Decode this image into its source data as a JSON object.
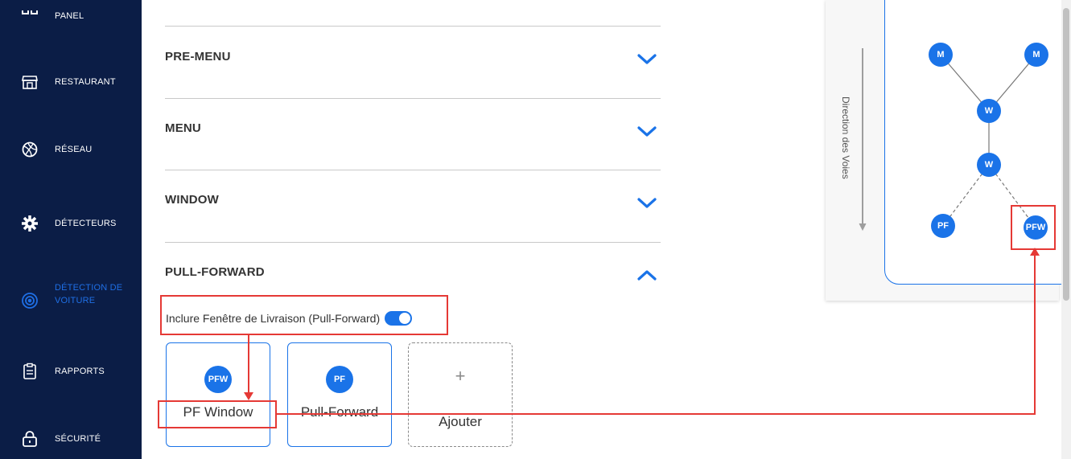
{
  "sidebar": {
    "items": [
      {
        "label": "PANEL",
        "icon": "dashboard-icon"
      },
      {
        "label": "RESTAURANT",
        "icon": "store-icon"
      },
      {
        "label": "RÉSEAU",
        "icon": "network-icon"
      },
      {
        "label": "DÉTECTEURS",
        "icon": "gear-icon"
      },
      {
        "label": "DÉTECTION DE VOITURE",
        "icon": "radar-icon",
        "active": true
      },
      {
        "label": "RAPPORTS",
        "icon": "clipboard-icon"
      },
      {
        "label": "SÉCURITÉ",
        "icon": "lock-icon"
      }
    ]
  },
  "accordion": {
    "sections": [
      {
        "title": "PRE-MENU",
        "expanded": false
      },
      {
        "title": "MENU",
        "expanded": false
      },
      {
        "title": "WINDOW",
        "expanded": false
      },
      {
        "title": "PULL-FORWARD",
        "expanded": true
      }
    ]
  },
  "pull_forward": {
    "toggle_label": "Inclure Fenêtre de Livraison (Pull-Forward)",
    "toggle_on": true,
    "cards": [
      {
        "badge": "PFW",
        "label": "PF Window"
      },
      {
        "badge": "PF",
        "label": "Pull-Forward"
      }
    ],
    "add_card": {
      "symbol": "+",
      "label": "Ajouter"
    }
  },
  "diagram": {
    "direction_label": "Direction des Voies",
    "nodes": {
      "m1": "M",
      "m2": "M",
      "w1": "W",
      "w2": "W",
      "pf": "PF",
      "pfw": "PFW"
    }
  },
  "colors": {
    "sidebar_bg": "#0b1d46",
    "accent": "#1a73e8",
    "highlight": "#e53935"
  }
}
